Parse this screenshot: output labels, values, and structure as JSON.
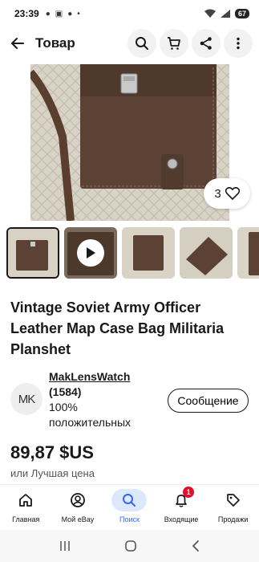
{
  "status": {
    "time": "23:39",
    "battery": "67"
  },
  "header": {
    "title": "Товар"
  },
  "listing": {
    "like_count": "3",
    "title": "Vintage Soviet Army Officer Leather Map Case Bag Militaria Planshet",
    "price": "89,87 $US",
    "price_subtext": "или Лучшая цена"
  },
  "seller": {
    "avatar_initials": "MK",
    "name": "MakLensWatch",
    "feedback_count": "(1584)",
    "positive_percent": "100%",
    "positive_label": "положительных",
    "message_button": "Сообщение"
  },
  "bottom_nav": [
    {
      "label": "Главная",
      "icon": "home-icon"
    },
    {
      "label": "Мой eBay",
      "icon": "account-icon"
    },
    {
      "label": "Поиск",
      "icon": "search-icon"
    },
    {
      "label": "Входящие",
      "icon": "bell-icon",
      "badge": "1"
    },
    {
      "label": "Продажи",
      "icon": "tag-icon"
    }
  ],
  "colors": {
    "accent": "#3665f3",
    "active_nav_bg": "#dce9fb",
    "badge": "#e0102d",
    "text": "#191919"
  }
}
